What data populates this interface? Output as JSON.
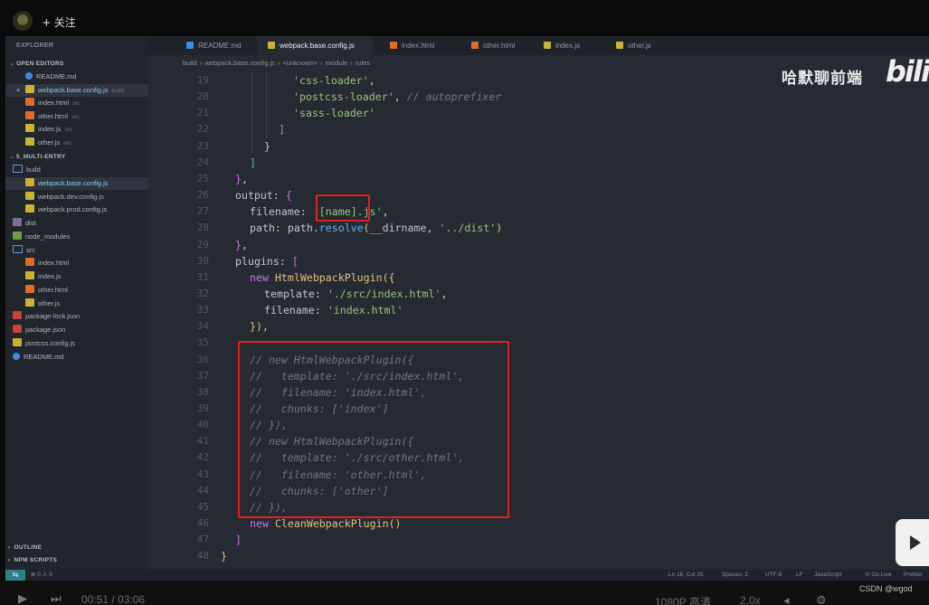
{
  "video": {
    "follow_label": "关注",
    "watermark_text": "哈默聊前端",
    "logo_text": "bilil",
    "time_current": "00:51",
    "time_total": "03:06",
    "quality": "1080P 高清",
    "speed": "2.0x",
    "credit": "CSDN @wgod"
  },
  "sidebar": {
    "title": "EXPLORER",
    "more": "···",
    "open_editors_label": "OPEN EDITORS",
    "open_editors": [
      {
        "name": "README.md",
        "hint": "",
        "icon": "markdown-icon"
      },
      {
        "name": "webpack.base.config.js",
        "hint": "build",
        "icon": "js-icon",
        "active": true
      },
      {
        "name": "index.html",
        "hint": "src",
        "icon": "html-icon"
      },
      {
        "name": "other.html",
        "hint": "src",
        "icon": "html-icon"
      },
      {
        "name": "index.js",
        "hint": "src",
        "icon": "js-icon"
      },
      {
        "name": "other.js",
        "hint": "src",
        "icon": "js-icon"
      }
    ],
    "project_label": "5_MULTI-ENTRY",
    "tree": [
      {
        "name": "build",
        "type": "folder",
        "indent": 1
      },
      {
        "name": "webpack.base.config.js",
        "type": "js",
        "indent": 2
      },
      {
        "name": "webpack.dev.config.js",
        "type": "js",
        "indent": 2
      },
      {
        "name": "webpack.prod.config.js",
        "type": "js",
        "indent": 2
      },
      {
        "name": "dist",
        "type": "folder",
        "indent": 1
      },
      {
        "name": "node_modules",
        "type": "folder",
        "indent": 1
      },
      {
        "name": "src",
        "type": "folder",
        "indent": 1
      },
      {
        "name": "index.html",
        "type": "html",
        "indent": 2
      },
      {
        "name": "index.js",
        "type": "js",
        "indent": 2
      },
      {
        "name": "other.html",
        "type": "html",
        "indent": 2
      },
      {
        "name": "other.js",
        "type": "js",
        "indent": 2
      },
      {
        "name": "package-lock.json",
        "type": "json",
        "indent": 1
      },
      {
        "name": "package.json",
        "type": "json",
        "indent": 1
      },
      {
        "name": "postcss.config.js",
        "type": "js",
        "indent": 1
      },
      {
        "name": "README.md",
        "type": "md",
        "indent": 1
      }
    ],
    "outline_label": "OUTLINE",
    "npm_label": "NPM SCRIPTS"
  },
  "tabs": [
    {
      "label": "README.md",
      "icon": "markdown-icon"
    },
    {
      "label": "webpack.base.config.js",
      "icon": "js-icon",
      "active": true
    },
    {
      "label": "index.html",
      "icon": "html-icon"
    },
    {
      "label": "other.html",
      "icon": "html-icon"
    },
    {
      "label": "index.js",
      "icon": "js-icon"
    },
    {
      "label": "other.js",
      "icon": "js-icon"
    }
  ],
  "breadcrumb": [
    "build",
    "webpack.base.config.js",
    "<unknown>",
    "module",
    "rules"
  ],
  "code": {
    "lines": [
      {
        "n": "19",
        "html": "<span class='str'>'css-loader'</span>,"
      },
      {
        "n": "20",
        "html": "<span class='str'>'postcss-loader'</span>, <span class='com'>// autoprefixer</span>"
      },
      {
        "n": "21",
        "html": "<span class='str'>'sass-loader'</span>"
      },
      {
        "n": "22",
        "html": "<span class='m'>]</span>"
      },
      {
        "n": "23",
        "html": "<span class='y'>}</span>"
      },
      {
        "n": "24",
        "html": "<span class='b'>]</span>"
      },
      {
        "n": "25",
        "html": "<span class='m'>}</span>,"
      },
      {
        "n": "26",
        "html": "<span class='key'>output</span>: <span class='m'>{</span>"
      },
      {
        "n": "27",
        "html": "<span class='key'>filename</span>: <span class='str'>'[name].js'</span>,"
      },
      {
        "n": "28",
        "html": "<span class='key'>path</span>: <span class='key'>path</span>.<span class='var'>resolve</span><span class='y'>(</span><span class='key'>__dirname</span>, <span class='str'>'../dist'</span><span class='y'>)</span>"
      },
      {
        "n": "29",
        "html": "<span class='m'>}</span>,"
      },
      {
        "n": "30",
        "html": "<span class='key'>plugins</span>: <span class='m'>[</span>"
      },
      {
        "n": "31",
        "html": "<span class='kw'>new</span> <span class='fn'>HtmlWebpackPlugin</span><span class='y'>({</span>"
      },
      {
        "n": "32",
        "html": "<span class='key'>template</span>: <span class='str'>'./src/index.html'</span>,"
      },
      {
        "n": "33",
        "html": "<span class='key'>filename</span>: <span class='str'>'index.html'</span>"
      },
      {
        "n": "34",
        "html": "<span class='y'>})</span>,"
      },
      {
        "n": "35",
        "html": ""
      },
      {
        "n": "36",
        "html": "<span class='com'>// new HtmlWebpackPlugin({</span>"
      },
      {
        "n": "37",
        "html": "<span class='com'>//   template: './src/index.html',</span>"
      },
      {
        "n": "38",
        "html": "<span class='com'>//   filename: 'index.html',</span>"
      },
      {
        "n": "39",
        "html": "<span class='com'>//   chunks: ['index']</span>"
      },
      {
        "n": "40",
        "html": "<span class='com'>// }),</span>"
      },
      {
        "n": "41",
        "html": "<span class='com'>// new HtmlWebpackPlugin({</span>"
      },
      {
        "n": "42",
        "html": "<span class='com'>//   template: './src/other.html',</span>"
      },
      {
        "n": "43",
        "html": "<span class='com'>//   filename: 'other.html',</span>"
      },
      {
        "n": "44",
        "html": "<span class='com'>//   chunks: ['other']</span>"
      },
      {
        "n": "45",
        "html": "<span class='com'>// }),</span>"
      },
      {
        "n": "46",
        "html": "<span class='kw'>new</span> <span class='fn'>CleanWebpackPlugin</span><span class='y'>()</span>"
      },
      {
        "n": "47",
        "html": "<span class='m'>]</span>"
      },
      {
        "n": "48",
        "html": "<span class='y'>}</span>"
      }
    ]
  },
  "status": {
    "remote": "⇆",
    "problems": "⊗ 0 ⚠ 0",
    "position": "Ln 16, Col 25",
    "spaces": "Spaces: 2",
    "encoding": "UTF-8",
    "eol": "LF",
    "language": "JavaScript",
    "golive": "⊙ Go Live",
    "prettier": "Prettier"
  },
  "colors": {
    "accent": "#7fd3e9",
    "annotation": "#e0201e",
    "editor_bg": "#262a33"
  }
}
